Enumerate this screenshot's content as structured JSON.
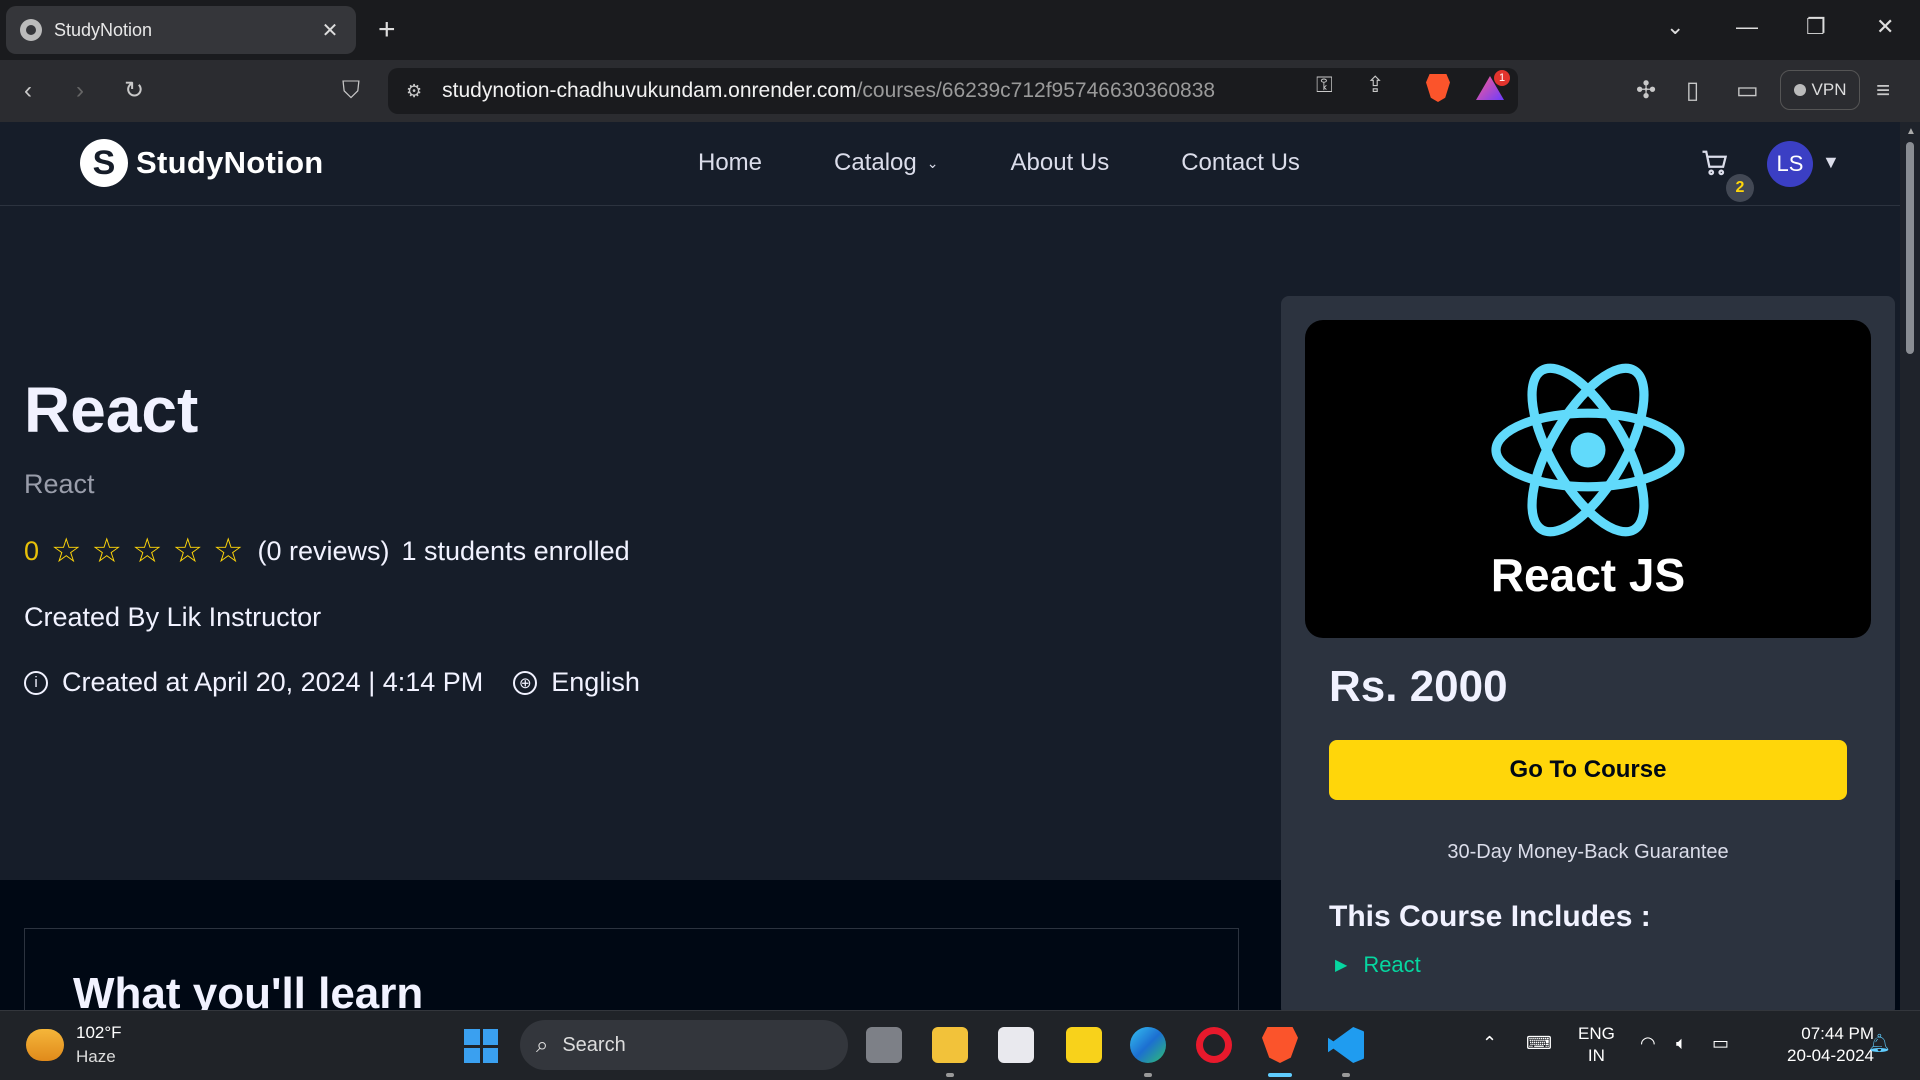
{
  "browser": {
    "tab_title": "StudyNotion",
    "tab_close": "✕",
    "new_tab": "+",
    "url_host": "studynotion-chadhuvukundam.onrender.com",
    "url_path": "/courses/66239c712f95746630360838",
    "vpn_label": "VPN",
    "brave_badge_count": "1"
  },
  "site": {
    "logo_letter": "S",
    "logo_name": "StudyNotion",
    "nav": {
      "home": "Home",
      "catalog": "Catalog",
      "about": "About Us",
      "contact": "Contact Us"
    },
    "cart_count": "2",
    "avatar_initials": "LS"
  },
  "course": {
    "title": "React",
    "description": "React",
    "avg_rating": "0",
    "stars": 5,
    "reviews": "(0 reviews)",
    "enrolled": "1 students enrolled",
    "created_by": "Created By Lik Instructor",
    "created_at": "Created at April 20, 2024 | 4:14 PM",
    "language": "English",
    "learn_heading": "What you'll learn"
  },
  "card": {
    "thumbnail_caption": "React JS",
    "price": "Rs. 2000",
    "cta": "Go To Course",
    "guarantee": "30-Day Money-Back Guarantee",
    "includes_title": "This Course Includes :",
    "includes": [
      "React"
    ]
  },
  "taskbar": {
    "temperature": "102°F",
    "condition": "Haze",
    "search_placeholder": "Search",
    "lang_line1": "ENG",
    "lang_line2": "IN",
    "time": "07:44 PM",
    "date": "20-04-2024"
  },
  "colors": {
    "page_bg": "#161D29",
    "card_bg": "#2C333F",
    "accent_yellow": "#FFD60A",
    "include_green": "#06D6A0",
    "react_cyan": "#61DAFB"
  }
}
